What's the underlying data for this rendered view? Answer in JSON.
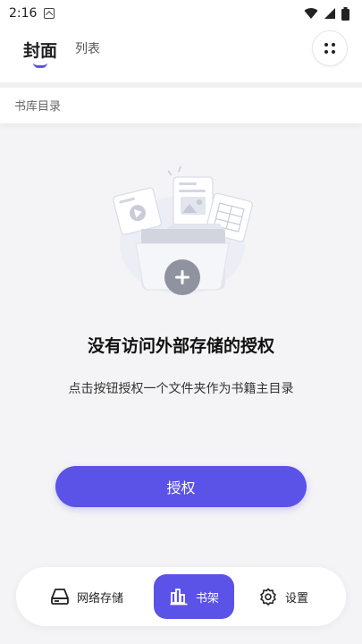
{
  "status_bar": {
    "time": "2:16",
    "icons": [
      "notification-app-icon",
      "wifi-icon",
      "signal-icon",
      "battery-icon"
    ]
  },
  "header": {
    "tabs": [
      {
        "label": "封面",
        "active": true
      },
      {
        "label": "列表",
        "active": false
      }
    ],
    "menu_icon": "grid-dots-icon"
  },
  "breadcrumb": {
    "label": "书库目录"
  },
  "empty_state": {
    "illustration_icon": "folder-documents-illustration",
    "title": "没有访问外部存储的授权",
    "subtitle": "点击按钮授权一个文件夹作为书籍主目录",
    "button_label": "授权"
  },
  "bottom_nav": {
    "items": [
      {
        "label": "网络存储",
        "icon": "network-storage-icon",
        "active": false
      },
      {
        "label": "书架",
        "icon": "bookshelf-icon",
        "active": true
      },
      {
        "label": "设置",
        "icon": "settings-gear-icon",
        "active": false
      }
    ]
  },
  "colors": {
    "accent": "#5b52e8",
    "background": "#f4f4f6",
    "surface": "#ffffff"
  }
}
